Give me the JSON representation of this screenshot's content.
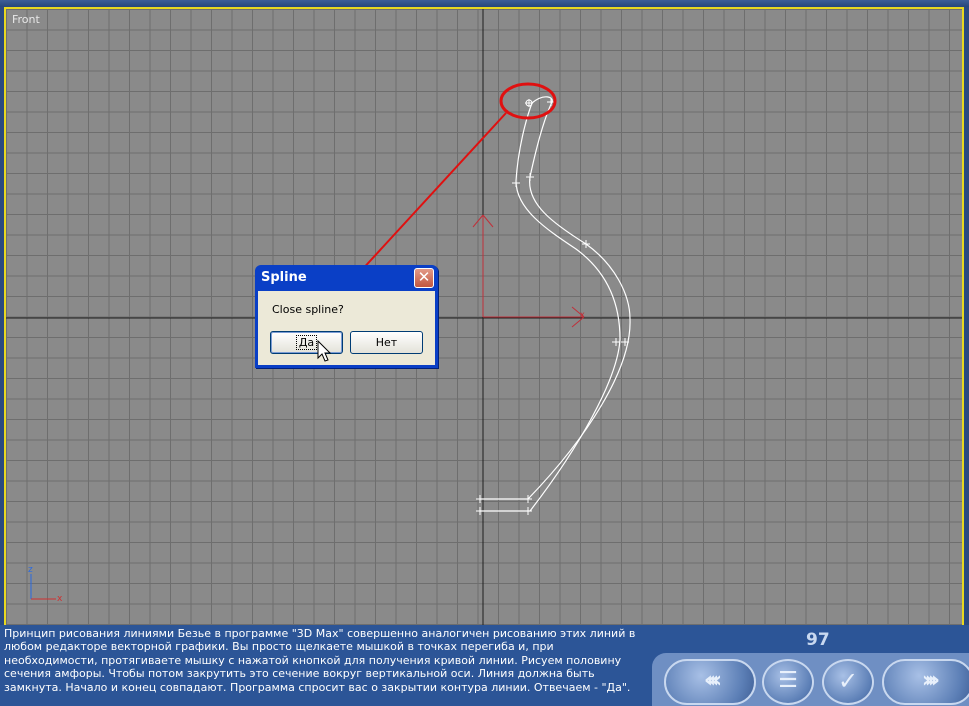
{
  "viewport": {
    "label": "Front"
  },
  "axes": {
    "x_label": "x",
    "z_label": "z"
  },
  "dialog": {
    "title": "Spline",
    "close_glyph": "✕",
    "message": "Close spline?",
    "yes_label": "Да",
    "no_label": "Нет"
  },
  "caption": {
    "text": "Принцип рисования линиями Безье в программе \"3D Max\" совершенно аналогичен рисованию этих линий в любом редакторе векторной графики. Вы просто щелкаете мышкой в точках перегиба и, при необходимости, протягиваете мышку с нажатой кнопкой для получения кривой линии. Рисуем половину сечения амфоры. Чтобы потом закрутить это сечение вокруг вертикальной оси. Линия должна быть замкнута. Начало и конец совпадают. Программа спросит вас о закрытии контура линии. Отвечаем - \"Да\"."
  },
  "page_number": "97",
  "nav": {
    "prev_glyph": "‹‹‹‹",
    "menu_glyph": "☰",
    "check_glyph": "✓",
    "next_glyph": "››››"
  },
  "colors": {
    "accent_red": "#e01010",
    "viewport_border": "#e8d820",
    "titlebar_blue": "#0a3fc6"
  }
}
